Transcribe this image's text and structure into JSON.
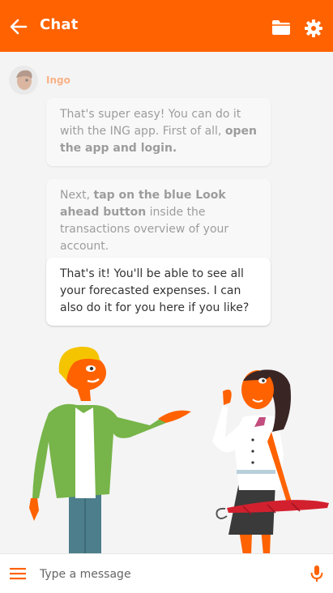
{
  "header": {
    "title": "Chat",
    "back_icon": "arrow-left-icon",
    "folder_icon": "folder-icon",
    "settings_icon": "gear-icon",
    "color": "#ff6200"
  },
  "conversation": {
    "sender_name": "Ingo",
    "messages": [
      {
        "parts": [
          {
            "text": "That's super easy! You can do it with the ING app. First of all, ",
            "bold": false
          },
          {
            "text": "open the app and login.",
            "bold": true
          }
        ],
        "faded": true
      },
      {
        "parts": [
          {
            "text": "Next, ",
            "bold": false
          },
          {
            "text": "tap on the blue Look ahead button",
            "bold": true
          },
          {
            "text": " inside the transactions overview of your account.",
            "bold": false
          }
        ],
        "faded": true
      },
      {
        "parts": [
          {
            "text": "That's it! You'll be able to see all your forecasted expenses. I can also do it for you here if you like?",
            "bold": false
          }
        ],
        "faded": false
      }
    ]
  },
  "composer": {
    "placeholder": "Type a message",
    "menu_icon": "hamburger-menu-icon",
    "mic_icon": "microphone-icon",
    "accent": "#ff6200"
  }
}
